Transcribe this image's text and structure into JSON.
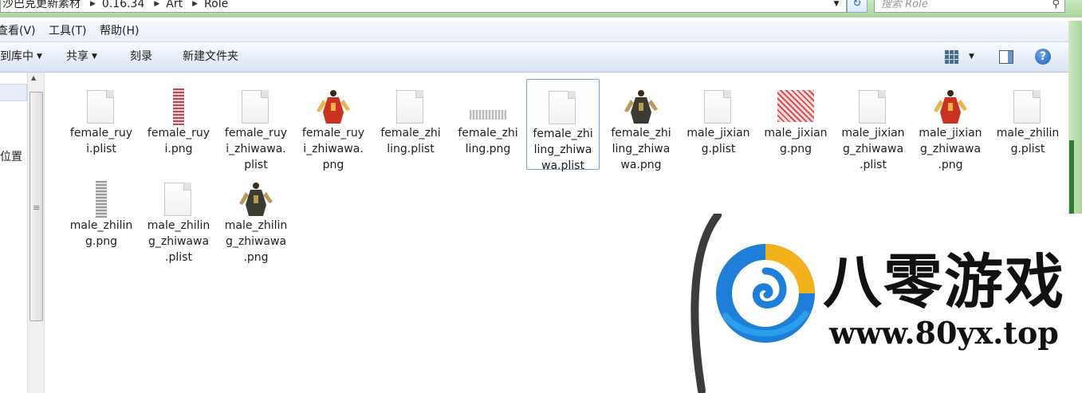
{
  "address": {
    "breadcrumbs": [
      "沙巴克更新素材",
      "0.16.34",
      "Art",
      "Role"
    ],
    "search_placeholder": "搜索 Role"
  },
  "menu": {
    "items": [
      "查看(V)",
      "工具(T)",
      "帮助(H)"
    ]
  },
  "commands": {
    "include_in_library": "包含到库中",
    "share": "共享",
    "burn": "刻录",
    "new_folder": "新建文件夹"
  },
  "nav": {
    "item": "位置"
  },
  "files": [
    {
      "name": "female_ruyi.plist",
      "icon": "plist-file-icon"
    },
    {
      "name": "female_ruyi.png",
      "icon": "sprite-strip-icon"
    },
    {
      "name": "female_ruyi_zhiwawa.plist",
      "icon": "plist-file-icon"
    },
    {
      "name": "female_ruyi_zhiwawa.png",
      "icon": "red-warrior-thumbnail"
    },
    {
      "name": "female_zhiling.plist",
      "icon": "plist-file-icon"
    },
    {
      "name": "female_zhiling.png",
      "icon": "sprite-strip-icon"
    },
    {
      "name": "female_zhiling_zhiwawa.plist",
      "icon": "plist-file-icon",
      "selected": true
    },
    {
      "name": "female_zhiling_zhiwawa.png",
      "icon": "dark-warrior-thumbnail"
    },
    {
      "name": "male_jixiang.plist",
      "icon": "plist-file-icon"
    },
    {
      "name": "male_jixiang.png",
      "icon": "red-sprite-sheet-icon"
    },
    {
      "name": "male_jixiang_zhiwawa.plist",
      "icon": "plist-file-icon"
    },
    {
      "name": "male_jixiang_zhiwawa.png",
      "icon": "red-warrior-thumbnail"
    },
    {
      "name": "male_zhiling.plist",
      "icon": "plist-file-icon"
    },
    {
      "name": "male_zhiling.png",
      "icon": "sprite-strip-icon"
    },
    {
      "name": "male_zhiling_zhiwawa.plist",
      "icon": "plist-file-icon"
    },
    {
      "name": "male_zhiling_zhiwawa.png",
      "icon": "dark-warrior-thumbnail"
    }
  ],
  "file_display_names": [
    [
      "female_ruy",
      "i.plist"
    ],
    [
      "female_ruy",
      "i.png"
    ],
    [
      "female_ruy",
      "i_zhiwawa.",
      "plist"
    ],
    [
      "female_ruy",
      "i_zhiwawa.",
      "png"
    ],
    [
      "female_zhi",
      "ling.plist"
    ],
    [
      "female_zhi",
      "ling.png"
    ],
    [
      "female_zhi",
      "ling_zhiwa",
      "wa.plist"
    ],
    [
      "female_zhi",
      "ling_zhiwa",
      "wa.png"
    ],
    [
      "male_jixian",
      "g.plist"
    ],
    [
      "male_jixian",
      "g.png"
    ],
    [
      "male_jixian",
      "g_zhiwawa",
      ".plist"
    ],
    [
      "male_jixian",
      "g_zhiwawa",
      ".png"
    ],
    [
      "male_zhilin",
      "g.plist"
    ],
    [
      "male_zhilin",
      "g.png"
    ],
    [
      "male_zhilin",
      "g_zhiwawa",
      ".plist"
    ],
    [
      "male_zhilin",
      "g_zhiwawa",
      ".png"
    ]
  ],
  "watermark": {
    "title": "八零游戏",
    "url": "www.80yx.top"
  },
  "colors": {
    "titlebar_green": "#a9d59c",
    "selection_border": "#7da2ce",
    "help_blue": "#1e5bb4"
  }
}
